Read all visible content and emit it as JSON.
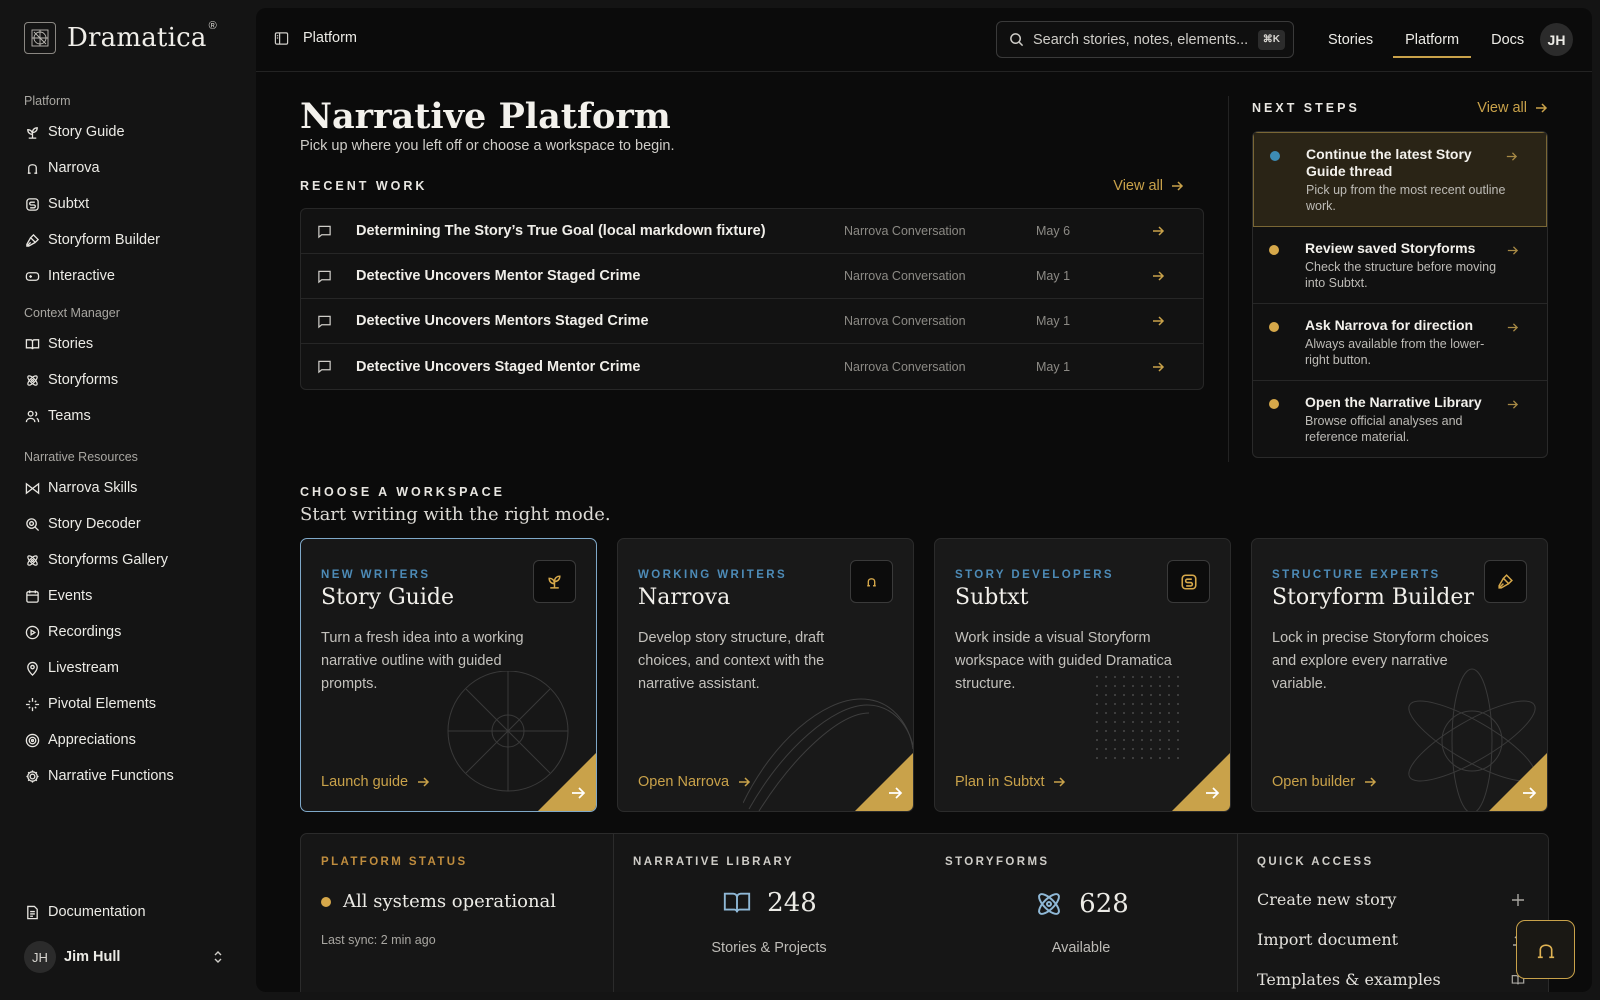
{
  "brand": {
    "name": "Dramatica",
    "reg": "®"
  },
  "sidebar": {
    "groups": [
      {
        "heading": "Platform",
        "items": [
          {
            "label": "Story Guide",
            "icon": "sprout-icon"
          },
          {
            "label": "Narrova",
            "icon": "narrova-icon"
          },
          {
            "label": "Subtxt",
            "icon": "subtxt-icon"
          },
          {
            "label": "Storyform Builder",
            "icon": "pen-tool-icon"
          },
          {
            "label": "Interactive",
            "icon": "gamepad-icon"
          }
        ]
      },
      {
        "heading": "Context Manager",
        "items": [
          {
            "label": "Stories",
            "icon": "book-open-icon"
          },
          {
            "label": "Storyforms",
            "icon": "atom-icon"
          },
          {
            "label": "Teams",
            "icon": "users-icon"
          }
        ]
      },
      {
        "heading": "Narrative Resources",
        "items": [
          {
            "label": "Narrova Skills",
            "icon": "bowtie-icon"
          },
          {
            "label": "Story Decoder",
            "icon": "scan-search-icon"
          },
          {
            "label": "Storyforms Gallery",
            "icon": "atom-icon"
          },
          {
            "label": "Events",
            "icon": "calendar-icon"
          },
          {
            "label": "Recordings",
            "icon": "play-circle-icon"
          },
          {
            "label": "Livestream",
            "icon": "map-pin-icon"
          },
          {
            "label": "Pivotal Elements",
            "icon": "sparkle-icon"
          },
          {
            "label": "Appreciations",
            "icon": "target-icon"
          },
          {
            "label": "Narrative Functions",
            "icon": "cog-icon"
          }
        ]
      }
    ],
    "footer": {
      "docs": "Documentation",
      "user_initials": "JH",
      "user_name": "Jim Hull"
    }
  },
  "topbar": {
    "breadcrumb": "Platform",
    "search_placeholder": "Search stories, notes, elements...",
    "search_kbd": "⌘K",
    "nav": [
      "Stories",
      "Platform",
      "Docs"
    ],
    "active_nav": "Platform",
    "avatar": "JH"
  },
  "page": {
    "title": "Narrative Platform",
    "subtitle": "Pick up where you left off or choose a workspace to begin."
  },
  "recent": {
    "label": "RECENT WORK",
    "view_all": "View all",
    "rows": [
      {
        "title": "Determining The Story’s True Goal (local markdown fixture)",
        "type": "Narrova Conversation",
        "date": "May 6"
      },
      {
        "title": "Detective Uncovers Mentor Staged Crime",
        "type": "Narrova Conversation",
        "date": "May 1"
      },
      {
        "title": "Detective Uncovers Mentors Staged Crime",
        "type": "Narrova Conversation",
        "date": "May 1"
      },
      {
        "title": "Detective Uncovers Staged Mentor Crime",
        "type": "Narrova Conversation",
        "date": "May 1"
      }
    ]
  },
  "next_steps": {
    "label": "NEXT STEPS",
    "view_all": "View all",
    "items": [
      {
        "title": "Continue the latest Story Guide thread",
        "desc": "Pick up from the most recent outline work.",
        "active": true
      },
      {
        "title": "Review saved Storyforms",
        "desc": "Check the structure before moving into Subtxt.",
        "active": false
      },
      {
        "title": "Ask Narrova for direction",
        "desc": "Always available from the lower-right button.",
        "active": false
      },
      {
        "title": "Open the Narrative Library",
        "desc": "Browse official analyses and reference material.",
        "active": false
      }
    ]
  },
  "workspace": {
    "label": "CHOOSE A WORKSPACE",
    "subtitle": "Start writing with the right mode.",
    "cards": [
      {
        "eyebrow": "NEW WRITERS",
        "title": "Story Guide",
        "desc": "Turn a fresh idea into a working narrative outline with guided prompts.",
        "cta": "Launch guide",
        "icon": "sprout-icon"
      },
      {
        "eyebrow": "WORKING WRITERS",
        "title": "Narrova",
        "desc": "Develop story structure, draft choices, and context with the narrative assistant.",
        "cta": "Open Narrova",
        "icon": "narrova-icon"
      },
      {
        "eyebrow": "STORY DEVELOPERS",
        "title": "Subtxt",
        "desc": "Work inside a visual Storyform workspace with guided Dramatica structure.",
        "cta": "Plan in Subtxt",
        "icon": "subtxt-icon"
      },
      {
        "eyebrow": "STRUCTURE EXPERTS",
        "title": "Storyform Builder",
        "desc": "Lock in precise Storyform choices and explore every narrative variable.",
        "cta": "Open builder",
        "icon": "pen-tool-icon"
      }
    ]
  },
  "stats": {
    "status": {
      "label": "PLATFORM STATUS",
      "text": "All systems operational",
      "sync": "Last sync: 2 min ago"
    },
    "library": {
      "label": "NARRATIVE LIBRARY",
      "value": "248",
      "caption": "Stories & Projects"
    },
    "storyforms": {
      "label": "STORYFORMS",
      "value": "628",
      "caption": "Available"
    },
    "quick": {
      "label": "QUICK ACCESS",
      "items": [
        "Create new story",
        "Import document",
        "Templates & examples"
      ]
    }
  },
  "colors": {
    "accent": "#c9a24a",
    "blue": "#4d8bb7",
    "bg": "#0b0b0b"
  }
}
